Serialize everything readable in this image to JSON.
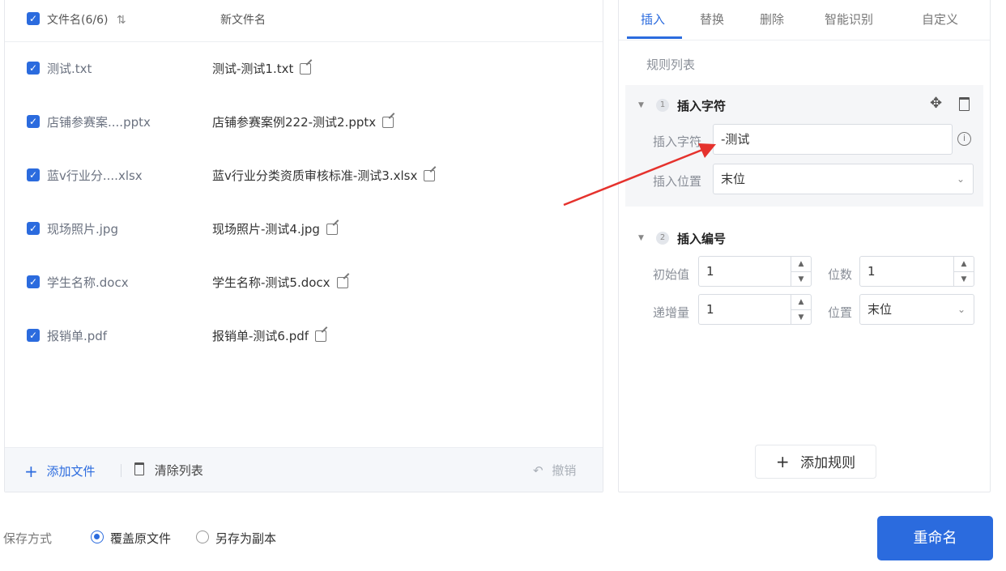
{
  "file_list": {
    "header_name": "文件名(6/6)",
    "header_sort_glyph": "⇅",
    "header_new": "新文件名",
    "rows": [
      {
        "old": "测试.txt",
        "new": "测试-测试1.txt"
      },
      {
        "old": "店铺参赛案....pptx",
        "new": "店铺参赛案例222-测试2.pptx"
      },
      {
        "old": "蓝v行业分....xlsx",
        "new": "蓝v行业分类资质审核标准-测试3.xlsx"
      },
      {
        "old": "现场照片.jpg",
        "new": "现场照片-测试4.jpg"
      },
      {
        "old": "学生名称.docx",
        "new": "学生名称-测试5.docx"
      },
      {
        "old": "报销单.pdf",
        "new": "报销单-测试6.pdf"
      }
    ],
    "footer": {
      "add_file": "添加文件",
      "clear_list": "清除列表",
      "undo": "撤销"
    }
  },
  "rules": {
    "tabs": [
      "插入",
      "替换",
      "删除",
      "智能识别",
      "自定义"
    ],
    "active_tab": "插入",
    "list_title": "规则列表",
    "rule1": {
      "index": "1",
      "title": "插入字符",
      "char_label": "插入字符",
      "char_value": "-测试",
      "pos_label": "插入位置",
      "pos_value": "末位"
    },
    "rule2": {
      "index": "2",
      "title": "插入编号",
      "start_label": "初始值",
      "start_value": "1",
      "digits_label": "位数",
      "digits_value": "1",
      "step_label": "递增量",
      "step_value": "1",
      "pos_label": "位置",
      "pos_value": "末位"
    },
    "add_rule": "添加规则"
  },
  "save": {
    "label": "保存方式",
    "option_overwrite": "覆盖原文件",
    "option_copy": "另存为副本",
    "selected": "覆盖原文件"
  },
  "rename_button": "重命名",
  "colors": {
    "accent": "#2b6bde",
    "annotation_arrow": "#e5322d"
  }
}
